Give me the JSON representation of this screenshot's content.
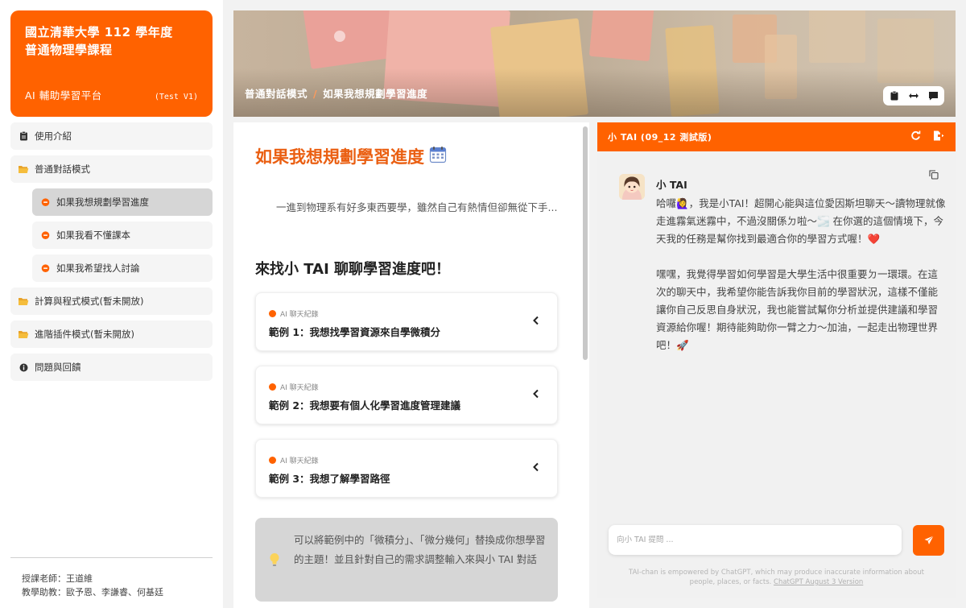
{
  "sidebar": {
    "brand": {
      "title_line1": "國立清華大學 112 學年度",
      "title_line2": "普通物理學課程",
      "subtitle": "AI 輔助學習平台",
      "version": "(Test V1)"
    },
    "items": [
      {
        "label": "使用介紹",
        "icon": "clipboard-icon"
      },
      {
        "label": "普通對話模式",
        "icon": "folder-open-icon"
      },
      {
        "label": "如果我想規劃學習進度",
        "icon": "chat-bubble-icon"
      },
      {
        "label": "如果我看不懂課本",
        "icon": "chat-bubble-icon"
      },
      {
        "label": "如果我希望找人討論",
        "icon": "chat-bubble-icon"
      },
      {
        "label": "計算與程式模式(暫未開放)",
        "icon": "folder-icon"
      },
      {
        "label": "進階插件模式(暫未開放)",
        "icon": "folder-icon"
      },
      {
        "label": "問題與回饋",
        "icon": "info-icon"
      }
    ],
    "footer": {
      "teacher": "授課老師：王道維",
      "assistants": "教學助教：歐予恩、李謙睿、何基廷"
    }
  },
  "banner": {
    "breadcrumb": [
      "普通對話模式",
      "如果我想規劃學習進度"
    ],
    "separator": "/"
  },
  "main": {
    "title": "如果我想規劃學習進度",
    "intro": "一進到物理系有好多東西要學，雖然自己有熱情但卻無從下手...",
    "subhead": "來找小 TAI 聊聊學習進度吧！",
    "examples": [
      {
        "tag": "AI 聊天紀錄",
        "title": "範例 1：我想找學習資源來自學微積分"
      },
      {
        "tag": "AI 聊天紀錄",
        "title": "範例 2：我想要有個人化學習進度管理建議"
      },
      {
        "tag": "AI 聊天紀錄",
        "title": "範例 3：我想了解學習路徑"
      }
    ],
    "tip": "可以將範例中的「微積分」、「微分幾何」替換成你想學習的主題！並且針對自己的需求調整輸入來與小 TAI 對話"
  },
  "chat": {
    "header": "小 TAI (09_12 測試版)",
    "sender": "小 TAI",
    "message_1": "哈囉🙋‍♀️，我是小TAI！超開心能與這位愛因斯坦聊天～讀物理就像走進霧氣迷霧中，不過沒關係ㄉ啦～🌫️ 在你選的這個情境下，今天我的任務是幫你找到最適合你的學習方式喔！❤️",
    "message_2": "嘿嘿，我覺得學習如何學習是大學生活中很重要ㄉ一環環。在這次的聊天中，我希望你能告訴我你目前的學習狀況，這樣不僅能讓你自己反思自身狀況，我也能嘗試幫你分析並提供建議和學習資源給你喔！期待能夠助你一臂之力～加油，一起走出物理世界吧！🚀",
    "input_placeholder": "向小 TAI 提問 ...",
    "disclaimer": "TAI-chan is empowered by ChatGPT, which may produce inaccurate information about people, places, or facts.",
    "disclaimer_link": "ChatGPT August 3 Version"
  },
  "colors": {
    "accent": "#ff6200",
    "title_orange": "#ea5f12",
    "active_nav": "#d6d6d6"
  }
}
